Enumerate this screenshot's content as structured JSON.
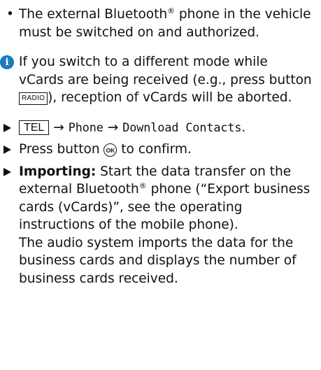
{
  "bullet": {
    "glyph": "•",
    "before": "The external Bluetooth",
    "reg": "®",
    "after": " phone in the vehicle must be switched on and authorized."
  },
  "info": {
    "icon": "i",
    "text1": "If you switch to a different mode while vCards are being received (e.g., press button ",
    "key": "RADIO",
    "text2": "), reception of vCards will be aborted."
  },
  "step1": {
    "key": "TEL",
    "arrow1": "→",
    "item1": "Phone",
    "arrow2": "→",
    "item2": "Download Contacts",
    "period": "."
  },
  "step2": {
    "before": "Press button ",
    "button": "OK",
    "after": " to confirm."
  },
  "step3": {
    "label": "Importing:",
    "text1": " Start the data transfer on the external Bluetooth",
    "reg": "®",
    "text2": " phone (“Export business cards (vCards)”, see the operating instructions of the mobile phone).",
    "line2": "The audio system imports the data for the business cards and displays the number of business cards received."
  },
  "colors": {
    "info_icon": "#1a7ac2",
    "text": "#111111"
  }
}
